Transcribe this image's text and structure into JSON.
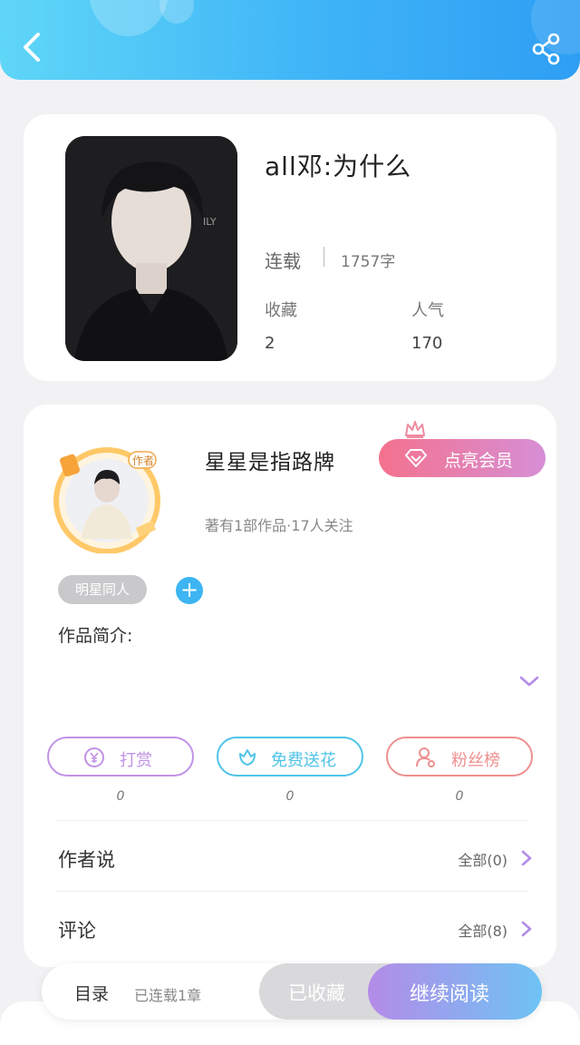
{
  "header": {
    "back_icon": "chevron-left-icon",
    "share_icon": "share-icon"
  },
  "book": {
    "title": "all邓:为什么",
    "status": "连载",
    "word_count": "1757字",
    "favorites_label": "收藏",
    "favorites_value": "2",
    "popularity_label": "人气",
    "popularity_value": "170"
  },
  "author": {
    "name": "星星是指路牌",
    "meta": "著有1部作品·17人关注",
    "avatar_badge": "作者",
    "vip_button": "点亮会员",
    "tag": "明星同人",
    "intro_label": "作品简介:"
  },
  "actions": [
    {
      "label": "打赏",
      "count": "0",
      "icon": "yen-coin-icon",
      "color": "#c191e6"
    },
    {
      "label": "免费送花",
      "count": "0",
      "icon": "flower-icon",
      "color": "#4fc4e9"
    },
    {
      "label": "粉丝榜",
      "count": "0",
      "icon": "fans-icon",
      "color": "#ee8f8f"
    }
  ],
  "rows": [
    {
      "label": "作者说",
      "right": "全部(0)"
    },
    {
      "label": "评论",
      "right": "全部(8)"
    }
  ],
  "bottom": {
    "toc": "目录",
    "progress": "已连载1章",
    "collected": "已收藏",
    "continue": "继续阅读"
  },
  "colors": {
    "header_gradient_start": "#5fd6f7",
    "header_gradient_end": "#2e9ef3",
    "accent_purple": "#b48be8"
  }
}
